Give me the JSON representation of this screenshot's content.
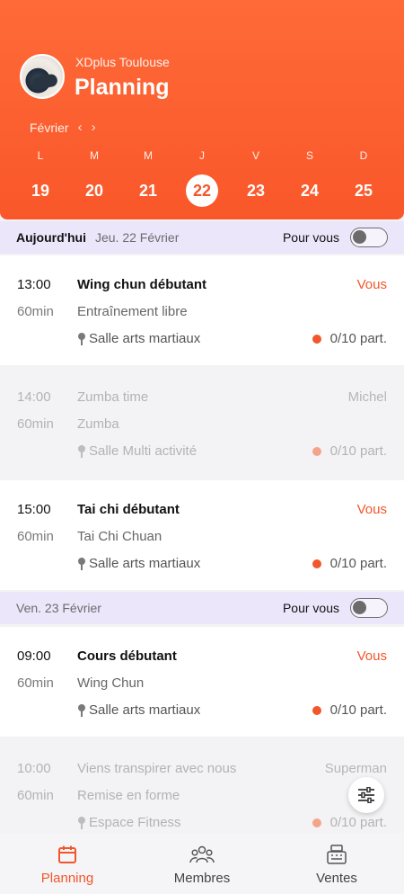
{
  "header": {
    "club": "XDplus Toulouse",
    "title": "Planning",
    "month": "Février",
    "prev": "‹",
    "next": "›",
    "days": [
      {
        "letter": "L",
        "num": "19"
      },
      {
        "letter": "M",
        "num": "20"
      },
      {
        "letter": "M",
        "num": "21"
      },
      {
        "letter": "J",
        "num": "22",
        "selected": true
      },
      {
        "letter": "V",
        "num": "23"
      },
      {
        "letter": "S",
        "num": "24"
      },
      {
        "letter": "D",
        "num": "25"
      }
    ]
  },
  "sections": [
    {
      "today": "Aujourd'hui",
      "date": "Jeu. 22 Février",
      "pour_vous": "Pour vous"
    },
    {
      "date": "Ven. 23 Février",
      "pour_vous": "Pour vous"
    }
  ],
  "classes": [
    {
      "time": "13:00",
      "duration": "60min",
      "name": "Wing chun débutant",
      "type": "Entraînement libre",
      "room": "Salle arts martiaux",
      "who": "Vous",
      "participants": "0/10 part."
    },
    {
      "time": "14:00",
      "duration": "60min",
      "name": "Zumba time",
      "type": "Zumba",
      "room": "Salle Multi activité",
      "who": "Michel",
      "participants": "0/10 part."
    },
    {
      "time": "15:00",
      "duration": "60min",
      "name": "Tai chi débutant",
      "type": "Tai Chi Chuan",
      "room": "Salle arts martiaux",
      "who": "Vous",
      "participants": "0/10 part."
    },
    {
      "time": "09:00",
      "duration": "60min",
      "name": "Cours débutant",
      "type": "Wing Chun",
      "room": "Salle arts martiaux",
      "who": "Vous",
      "participants": "0/10 part."
    },
    {
      "time": "10:00",
      "duration": "60min",
      "name": "Viens transpirer avec nous",
      "type": "Remise en forme",
      "room": "Espace Fitness",
      "who": "Superman",
      "participants": "0/10 part."
    }
  ],
  "tabs": [
    {
      "label": "Planning",
      "icon": "calendar-icon",
      "active": true
    },
    {
      "label": "Membres",
      "icon": "users-icon"
    },
    {
      "label": "Ventes",
      "icon": "cash-register-icon"
    }
  ],
  "colors": {
    "accent": "#f2572b",
    "section_bg": "#ece6fb"
  }
}
